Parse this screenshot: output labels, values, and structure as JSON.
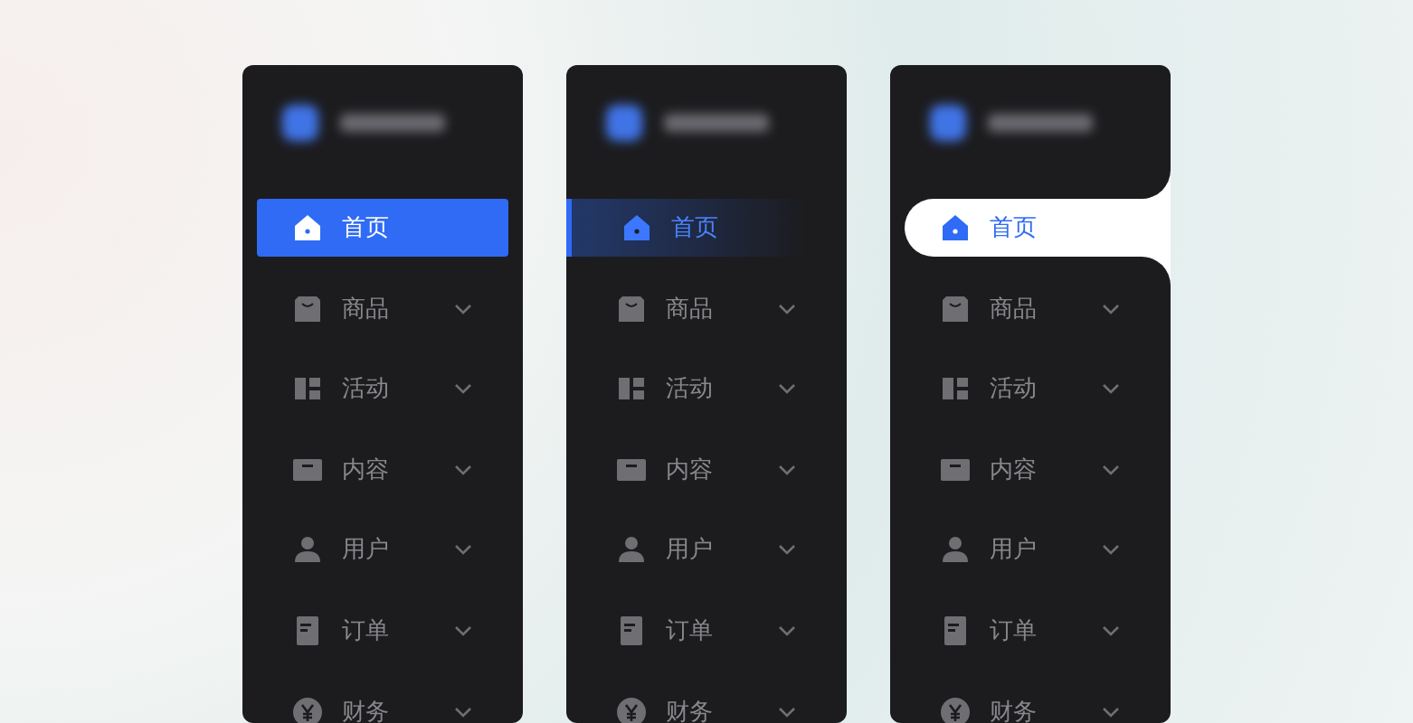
{
  "panels": [
    {
      "kind": "filled",
      "items": [
        {
          "label": "首页",
          "selected": true,
          "expandable": false
        },
        {
          "label": "商品",
          "selected": false,
          "expandable": true
        },
        {
          "label": "活动",
          "selected": false,
          "expandable": true
        },
        {
          "label": "内容",
          "selected": false,
          "expandable": true
        },
        {
          "label": "用户",
          "selected": false,
          "expandable": true
        },
        {
          "label": "订单",
          "selected": false,
          "expandable": true
        },
        {
          "label": "财务",
          "selected": false,
          "expandable": true
        }
      ]
    },
    {
      "kind": "gradient",
      "items": [
        {
          "label": "首页",
          "selected": true,
          "expandable": false
        },
        {
          "label": "商品",
          "selected": false,
          "expandable": true
        },
        {
          "label": "活动",
          "selected": false,
          "expandable": true
        },
        {
          "label": "内容",
          "selected": false,
          "expandable": true
        },
        {
          "label": "用户",
          "selected": false,
          "expandable": true
        },
        {
          "label": "订单",
          "selected": false,
          "expandable": true
        },
        {
          "label": "财务",
          "selected": false,
          "expandable": true
        }
      ]
    },
    {
      "kind": "tab",
      "items": [
        {
          "label": "首页",
          "selected": true,
          "expandable": false
        },
        {
          "label": "商品",
          "selected": false,
          "expandable": true
        },
        {
          "label": "活动",
          "selected": false,
          "expandable": true
        },
        {
          "label": "内容",
          "selected": false,
          "expandable": true
        },
        {
          "label": "用户",
          "selected": false,
          "expandable": true
        },
        {
          "label": "订单",
          "selected": false,
          "expandable": true
        },
        {
          "label": "财务",
          "selected": false,
          "expandable": true
        }
      ]
    }
  ]
}
